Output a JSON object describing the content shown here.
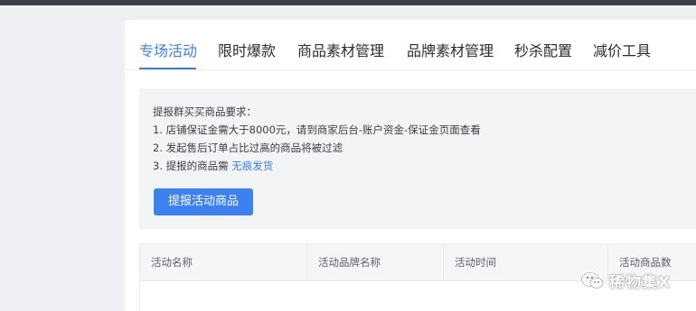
{
  "tabs": [
    {
      "label": "专场活动",
      "active": true
    },
    {
      "label": "限时爆款",
      "active": false
    },
    {
      "label": "商品素材管理",
      "active": false
    },
    {
      "label": "品牌素材管理",
      "active": false
    },
    {
      "label": "秒杀配置",
      "active": false
    },
    {
      "label": "减价工具",
      "active": false
    }
  ],
  "notice": {
    "title": "提报群买买商品要求：",
    "line1": "1. 店铺保证金需大于8000元，请到商家后台-账户资金-保证金页面查看",
    "line2": "2. 发起售后订单占比过高的商品将被过滤",
    "line3_prefix": "3. 提报的商品需 ",
    "line3_link": "无痕发货"
  },
  "actions": {
    "submit_label": "提报活动商品"
  },
  "table": {
    "columns": [
      "活动名称",
      "活动品牌名称",
      "活动时间",
      "活动商品数"
    ]
  },
  "watermark": {
    "text": "稀物集X",
    "icon": "wechat-official-account-icon"
  },
  "colors": {
    "accent": "#3d7fe6",
    "topbar": "#3c4048",
    "notice_bg": "#f3f4f6"
  }
}
